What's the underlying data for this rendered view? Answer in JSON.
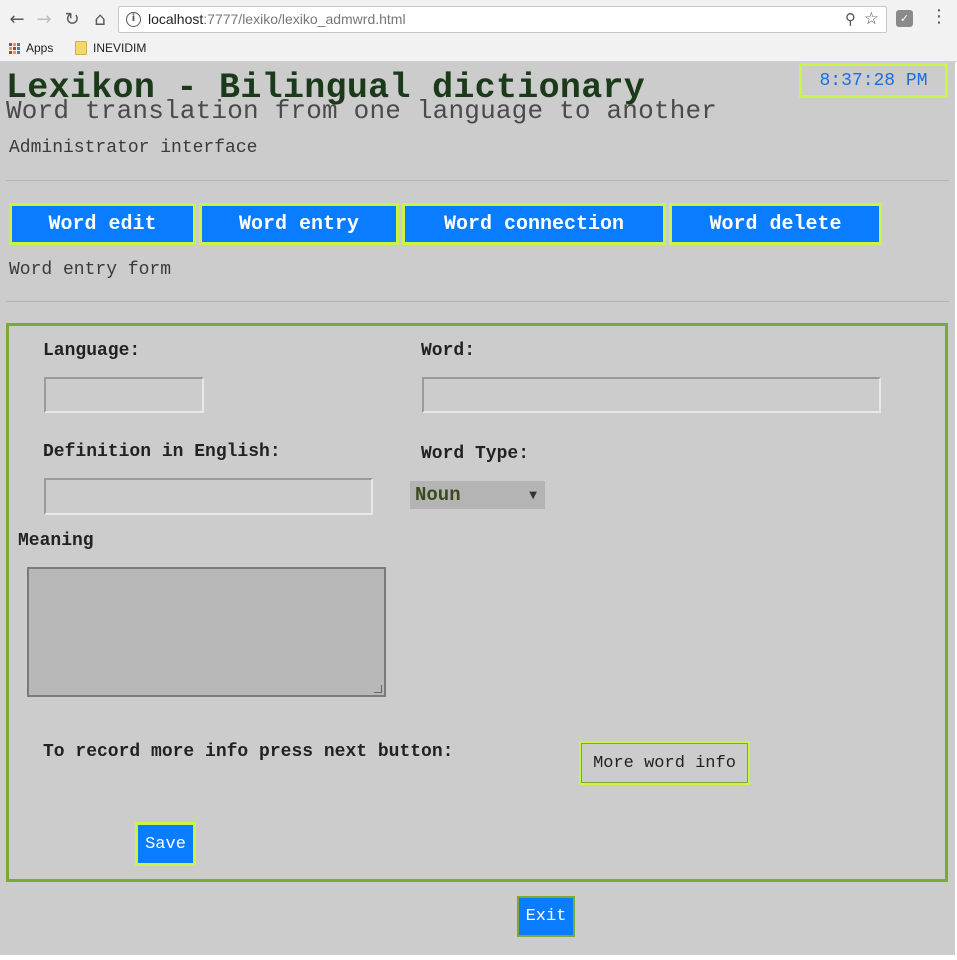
{
  "browser": {
    "url_host": "localhost",
    "url_rest": ":7777/lexiko/lexiko_admwrd.html",
    "bookmarks": [
      "Apps",
      "INEVIDIM"
    ]
  },
  "header": {
    "title": "Lexikon - Bilingual dictionary",
    "subtitle": "Word translation from one language to another",
    "section": "Administrator interface",
    "clock": "8:37:28 PM"
  },
  "tabs": [
    {
      "label": "Word edit"
    },
    {
      "label": "Word entry"
    },
    {
      "label": "Word connection"
    },
    {
      "label": "Word delete"
    }
  ],
  "form": {
    "heading": "Word entry form",
    "language_label": "Language:",
    "language_value": "",
    "word_label": "Word:",
    "word_value": "",
    "definition_label": "Definition in English:",
    "definition_value": "",
    "word_type_label": "Word Type:",
    "word_type_value": "Noun",
    "meaning_label": "Meaning",
    "meaning_value": "",
    "more_info_text": "To record more info press next button:",
    "more_info_button": "More word info",
    "save_button": "Save"
  },
  "exit_button": "Exit",
  "colors": {
    "page_bg": "#cccccc",
    "button_blue": "#0a7cff",
    "highlight_border": "#ccf542",
    "frame_green": "#7aa934",
    "clock_text": "#1a6fe0"
  },
  "icons": [
    "back-arrow-icon",
    "forward-arrow-icon",
    "reload-icon",
    "home-icon",
    "info-icon",
    "zoom-icon",
    "star-icon",
    "extension-icon",
    "menu-dots-icon",
    "apps-grid-icon",
    "folder-icon"
  ]
}
